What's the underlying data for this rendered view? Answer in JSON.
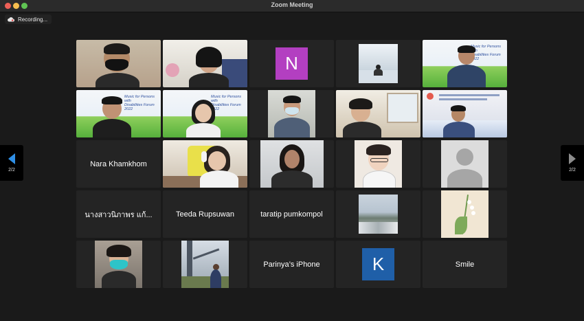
{
  "window": {
    "title": "Zoom Meeting"
  },
  "recording": {
    "label": "Recording...",
    "icon": "cloud-icon"
  },
  "navigation": {
    "prev_page": "2/2",
    "next_page": "2/2"
  },
  "banner": {
    "text_line1": "Music for Persons with",
    "text_line2": "Disabilities Forum 2022"
  },
  "participants": {
    "nara": "Nara Khamkhom",
    "nang": "นางสาวนิภาพร แก้...",
    "teeda": "Teeda Rupsuwan",
    "taratip": "taratip pumkompol",
    "parinya": "Parinya’s iPhone",
    "smile": "Smile",
    "n_initial": "N",
    "k_initial": "K"
  },
  "colors": {
    "n_avatar": "#b33fc1",
    "k_avatar": "#1f5fa8",
    "page_arrow": "#2f8fe6"
  }
}
